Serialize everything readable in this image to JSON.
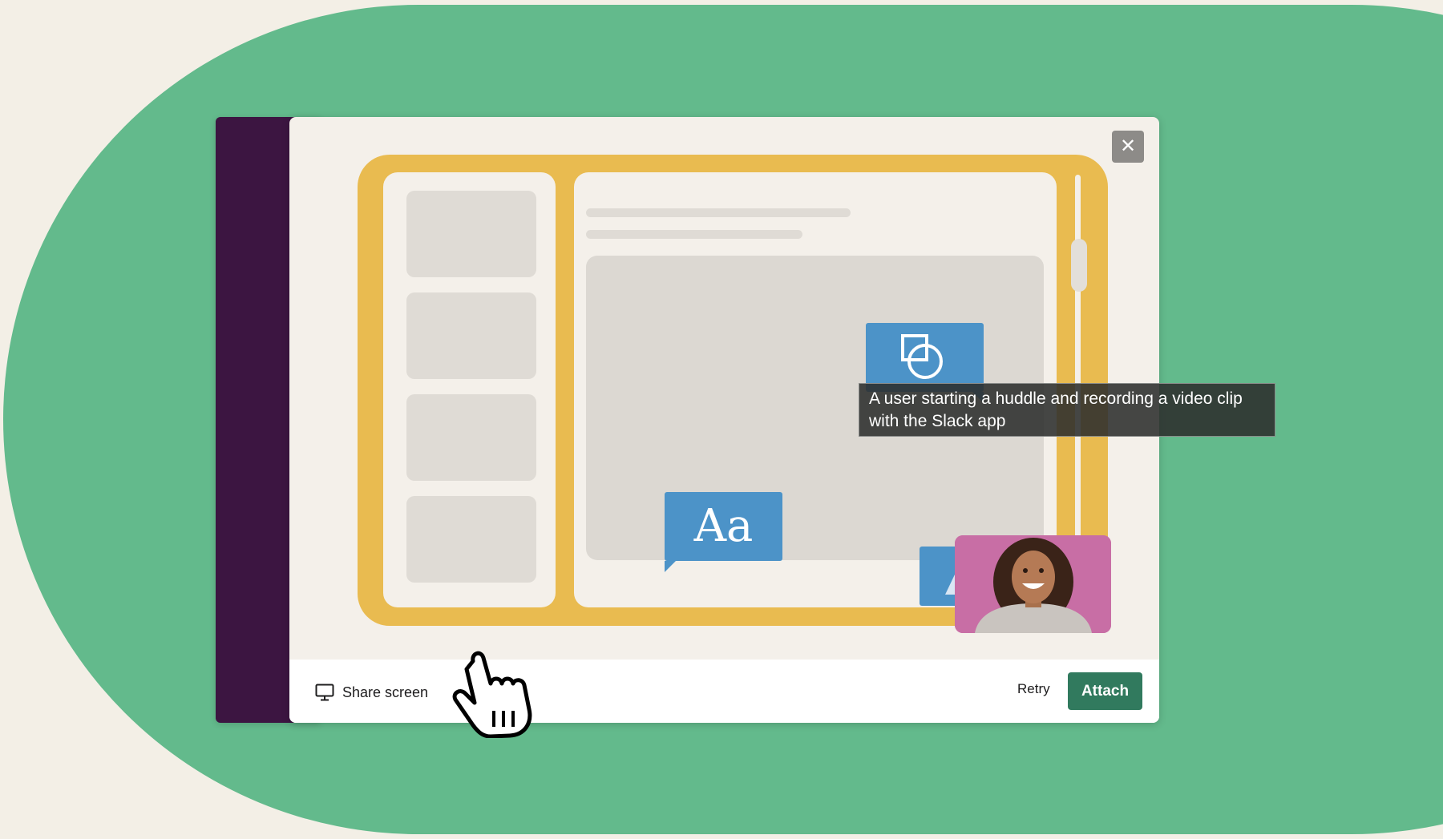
{
  "modal": {
    "close_icon": "close-icon",
    "close_glyph": "✕"
  },
  "illustration": {
    "text_bubble": "Aa",
    "shapes_icon": "shapes-icon",
    "image_icon": "image-icon"
  },
  "footer": {
    "share_screen_icon": "monitor-icon",
    "share_screen_label": "Share screen",
    "retry_label": "Retry",
    "attach_label": "Attach"
  },
  "tooltip": {
    "text": "A user starting a huddle and recording a video clip with the Slack app"
  },
  "colors": {
    "background": "#f3efe6",
    "green": "#63ba8c",
    "sidebar": "#3c1541",
    "illustration_frame": "#e9bb50",
    "bubble": "#4c93c8",
    "attach_button": "#317a5e",
    "video_background": "#c86ea5"
  }
}
